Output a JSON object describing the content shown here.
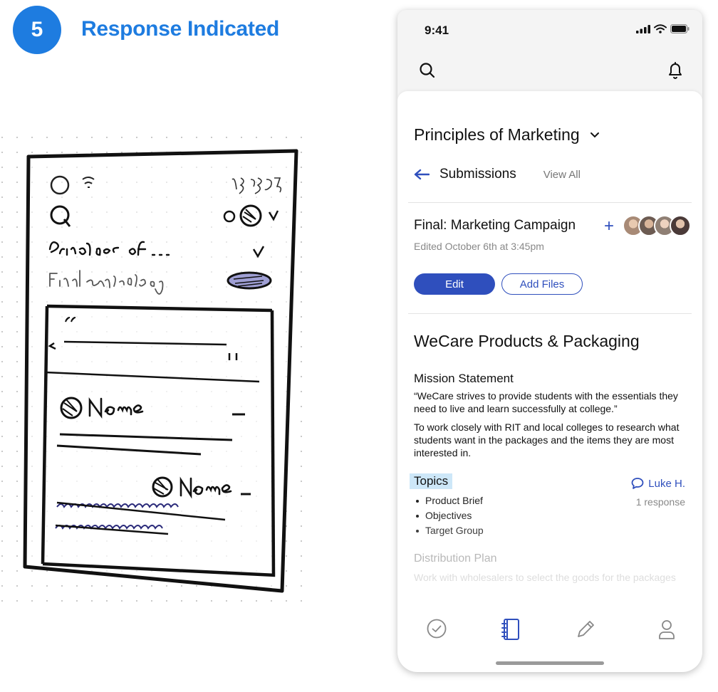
{
  "step": {
    "number": "5",
    "title": "Response Indicated"
  },
  "phone": {
    "status_time": "9:41",
    "course": "Principles of Marketing",
    "nav": {
      "back_label": "Submissions",
      "view_all": "View All"
    },
    "assignment": {
      "title": "Final: Marketing Campaign",
      "edited": "Edited October 6th at 3:45pm",
      "edit_button": "Edit",
      "add_files_button": "Add Files",
      "collaborator_colors": [
        "#a88a76",
        "#6c5b52",
        "#8f7f74",
        "#4a3a38"
      ]
    },
    "document": {
      "title": "WeCare Products & Packaging",
      "mission_heading": "Mission Statement",
      "mission_quote": "“WeCare strives to provide students with the essentials they need to live and learn successfully at college.”",
      "mission_text": "To work closely with RIT and local colleges to research what students want in the packages and the items they are most interested in.",
      "topics_label": "Topics",
      "topics": [
        "Product Brief",
        "Objectives",
        "Target Group"
      ],
      "comment_author": "Luke H.",
      "comment_count": "1 response",
      "distribution_heading": "Distribution Plan",
      "distribution_text": "Work with wholesalers to select the goods for the packages"
    },
    "tabs": [
      "check-circle-icon",
      "notebook-icon",
      "pencil-icon",
      "person-icon"
    ],
    "colors": {
      "accent": "#2f4fbd",
      "badge": "#1e7ce0",
      "highlight": "#cde7f8"
    }
  }
}
